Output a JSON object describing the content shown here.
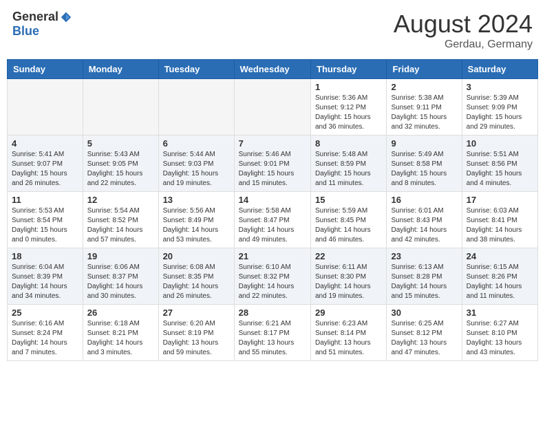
{
  "header": {
    "logo_general": "General",
    "logo_blue": "Blue",
    "month_year": "August 2024",
    "location": "Gerdau, Germany"
  },
  "days_of_week": [
    "Sunday",
    "Monday",
    "Tuesday",
    "Wednesday",
    "Thursday",
    "Friday",
    "Saturday"
  ],
  "weeks": [
    [
      {
        "day": "",
        "info": ""
      },
      {
        "day": "",
        "info": ""
      },
      {
        "day": "",
        "info": ""
      },
      {
        "day": "",
        "info": ""
      },
      {
        "day": "1",
        "info": "Sunrise: 5:36 AM\nSunset: 9:12 PM\nDaylight: 15 hours\nand 36 minutes."
      },
      {
        "day": "2",
        "info": "Sunrise: 5:38 AM\nSunset: 9:11 PM\nDaylight: 15 hours\nand 32 minutes."
      },
      {
        "day": "3",
        "info": "Sunrise: 5:39 AM\nSunset: 9:09 PM\nDaylight: 15 hours\nand 29 minutes."
      }
    ],
    [
      {
        "day": "4",
        "info": "Sunrise: 5:41 AM\nSunset: 9:07 PM\nDaylight: 15 hours\nand 26 minutes."
      },
      {
        "day": "5",
        "info": "Sunrise: 5:43 AM\nSunset: 9:05 PM\nDaylight: 15 hours\nand 22 minutes."
      },
      {
        "day": "6",
        "info": "Sunrise: 5:44 AM\nSunset: 9:03 PM\nDaylight: 15 hours\nand 19 minutes."
      },
      {
        "day": "7",
        "info": "Sunrise: 5:46 AM\nSunset: 9:01 PM\nDaylight: 15 hours\nand 15 minutes."
      },
      {
        "day": "8",
        "info": "Sunrise: 5:48 AM\nSunset: 8:59 PM\nDaylight: 15 hours\nand 11 minutes."
      },
      {
        "day": "9",
        "info": "Sunrise: 5:49 AM\nSunset: 8:58 PM\nDaylight: 15 hours\nand 8 minutes."
      },
      {
        "day": "10",
        "info": "Sunrise: 5:51 AM\nSunset: 8:56 PM\nDaylight: 15 hours\nand 4 minutes."
      }
    ],
    [
      {
        "day": "11",
        "info": "Sunrise: 5:53 AM\nSunset: 8:54 PM\nDaylight: 15 hours\nand 0 minutes."
      },
      {
        "day": "12",
        "info": "Sunrise: 5:54 AM\nSunset: 8:52 PM\nDaylight: 14 hours\nand 57 minutes."
      },
      {
        "day": "13",
        "info": "Sunrise: 5:56 AM\nSunset: 8:49 PM\nDaylight: 14 hours\nand 53 minutes."
      },
      {
        "day": "14",
        "info": "Sunrise: 5:58 AM\nSunset: 8:47 PM\nDaylight: 14 hours\nand 49 minutes."
      },
      {
        "day": "15",
        "info": "Sunrise: 5:59 AM\nSunset: 8:45 PM\nDaylight: 14 hours\nand 46 minutes."
      },
      {
        "day": "16",
        "info": "Sunrise: 6:01 AM\nSunset: 8:43 PM\nDaylight: 14 hours\nand 42 minutes."
      },
      {
        "day": "17",
        "info": "Sunrise: 6:03 AM\nSunset: 8:41 PM\nDaylight: 14 hours\nand 38 minutes."
      }
    ],
    [
      {
        "day": "18",
        "info": "Sunrise: 6:04 AM\nSunset: 8:39 PM\nDaylight: 14 hours\nand 34 minutes."
      },
      {
        "day": "19",
        "info": "Sunrise: 6:06 AM\nSunset: 8:37 PM\nDaylight: 14 hours\nand 30 minutes."
      },
      {
        "day": "20",
        "info": "Sunrise: 6:08 AM\nSunset: 8:35 PM\nDaylight: 14 hours\nand 26 minutes."
      },
      {
        "day": "21",
        "info": "Sunrise: 6:10 AM\nSunset: 8:32 PM\nDaylight: 14 hours\nand 22 minutes."
      },
      {
        "day": "22",
        "info": "Sunrise: 6:11 AM\nSunset: 8:30 PM\nDaylight: 14 hours\nand 19 minutes."
      },
      {
        "day": "23",
        "info": "Sunrise: 6:13 AM\nSunset: 8:28 PM\nDaylight: 14 hours\nand 15 minutes."
      },
      {
        "day": "24",
        "info": "Sunrise: 6:15 AM\nSunset: 8:26 PM\nDaylight: 14 hours\nand 11 minutes."
      }
    ],
    [
      {
        "day": "25",
        "info": "Sunrise: 6:16 AM\nSunset: 8:24 PM\nDaylight: 14 hours\nand 7 minutes."
      },
      {
        "day": "26",
        "info": "Sunrise: 6:18 AM\nSunset: 8:21 PM\nDaylight: 14 hours\nand 3 minutes."
      },
      {
        "day": "27",
        "info": "Sunrise: 6:20 AM\nSunset: 8:19 PM\nDaylight: 13 hours\nand 59 minutes."
      },
      {
        "day": "28",
        "info": "Sunrise: 6:21 AM\nSunset: 8:17 PM\nDaylight: 13 hours\nand 55 minutes."
      },
      {
        "day": "29",
        "info": "Sunrise: 6:23 AM\nSunset: 8:14 PM\nDaylight: 13 hours\nand 51 minutes."
      },
      {
        "day": "30",
        "info": "Sunrise: 6:25 AM\nSunset: 8:12 PM\nDaylight: 13 hours\nand 47 minutes."
      },
      {
        "day": "31",
        "info": "Sunrise: 6:27 AM\nSunset: 8:10 PM\nDaylight: 13 hours\nand 43 minutes."
      }
    ]
  ]
}
